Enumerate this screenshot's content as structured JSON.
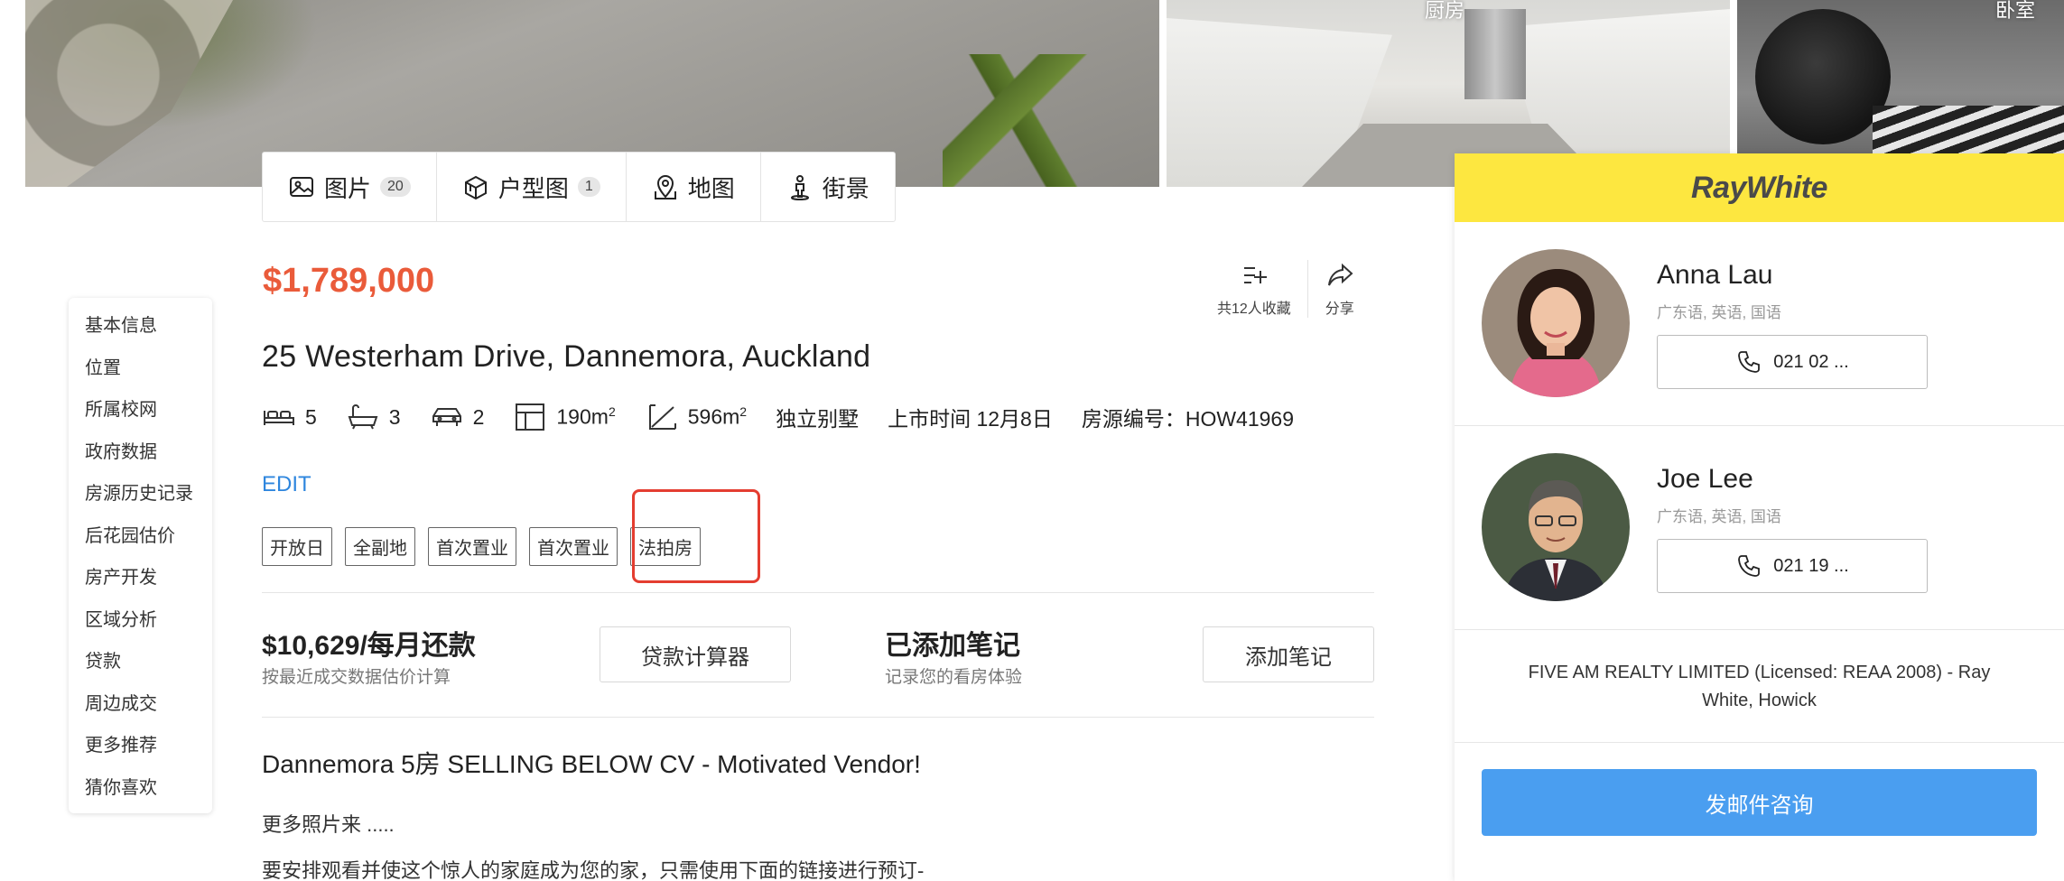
{
  "photos": {
    "kitchen_label": "厨房",
    "bedroom_label": "卧室"
  },
  "media_tabs": [
    {
      "label": "图片",
      "badge": "20",
      "icon": "image-icon"
    },
    {
      "label": "户型图",
      "badge": "1",
      "icon": "floorplan-icon"
    },
    {
      "label": "地图",
      "badge": "",
      "icon": "map-pin-icon"
    },
    {
      "label": "街景",
      "badge": "",
      "icon": "street-view-icon"
    }
  ],
  "side_nav": [
    "基本信息",
    "位置",
    "所属校网",
    "政府数据",
    "房源历史记录",
    "后花园估价",
    "房产开发",
    "区域分析",
    "贷款",
    "周边成交",
    "更多推荐",
    "猜你喜欢"
  ],
  "listing": {
    "price": "$1,789,000",
    "favorite_label": "共12人收藏",
    "share_label": "分享",
    "address": "25 Westerham Drive, Dannemora, Auckland",
    "bedrooms": "5",
    "bathrooms": "3",
    "parking": "2",
    "floor_area": "190m",
    "land_area": "596m",
    "area_unit_sup": "2",
    "property_type": "独立别墅",
    "listed_date": "上市时间 12月8日",
    "listing_id": "房源编号：HOW41969",
    "edit_label": "EDIT",
    "tags": [
      "开放日",
      "全副地",
      "首次置业",
      "首次置业",
      "法拍房"
    ]
  },
  "mortgage": {
    "title": "$10,629/每月还款",
    "subtitle": "按最近成交数据估价计算",
    "button": "贷款计算器"
  },
  "notes": {
    "title": "已添加笔记",
    "subtitle": "记录您的看房体验",
    "button": "添加笔记"
  },
  "description": {
    "title": "Dannemora 5房 SELLING BELOW CV - Motivated Vendor!",
    "line1": "更多照片来 .....",
    "line2": "要安排观看并使这个惊人的家庭成为您的家，只需使用下面的链接进行预订-"
  },
  "agent_card": {
    "brand": "RayWhite",
    "brand_color": "#fde740",
    "agents": [
      {
        "name": "Anna Lau",
        "languages": "广东语, 英语, 国语",
        "phone": "021 02 ..."
      },
      {
        "name": "Joe Lee",
        "languages": "广东语, 英语, 国语",
        "phone": "021 19 ..."
      }
    ],
    "company": "FIVE AM REALTY LIMITED (Licensed: REAA 2008) - Ray White, Howick",
    "email_button": "发邮件咨询"
  },
  "colors": {
    "price": "#ea5b3a",
    "link": "#2e86de",
    "highlight": "#e43d30",
    "email_button": "#4a9ef0"
  }
}
